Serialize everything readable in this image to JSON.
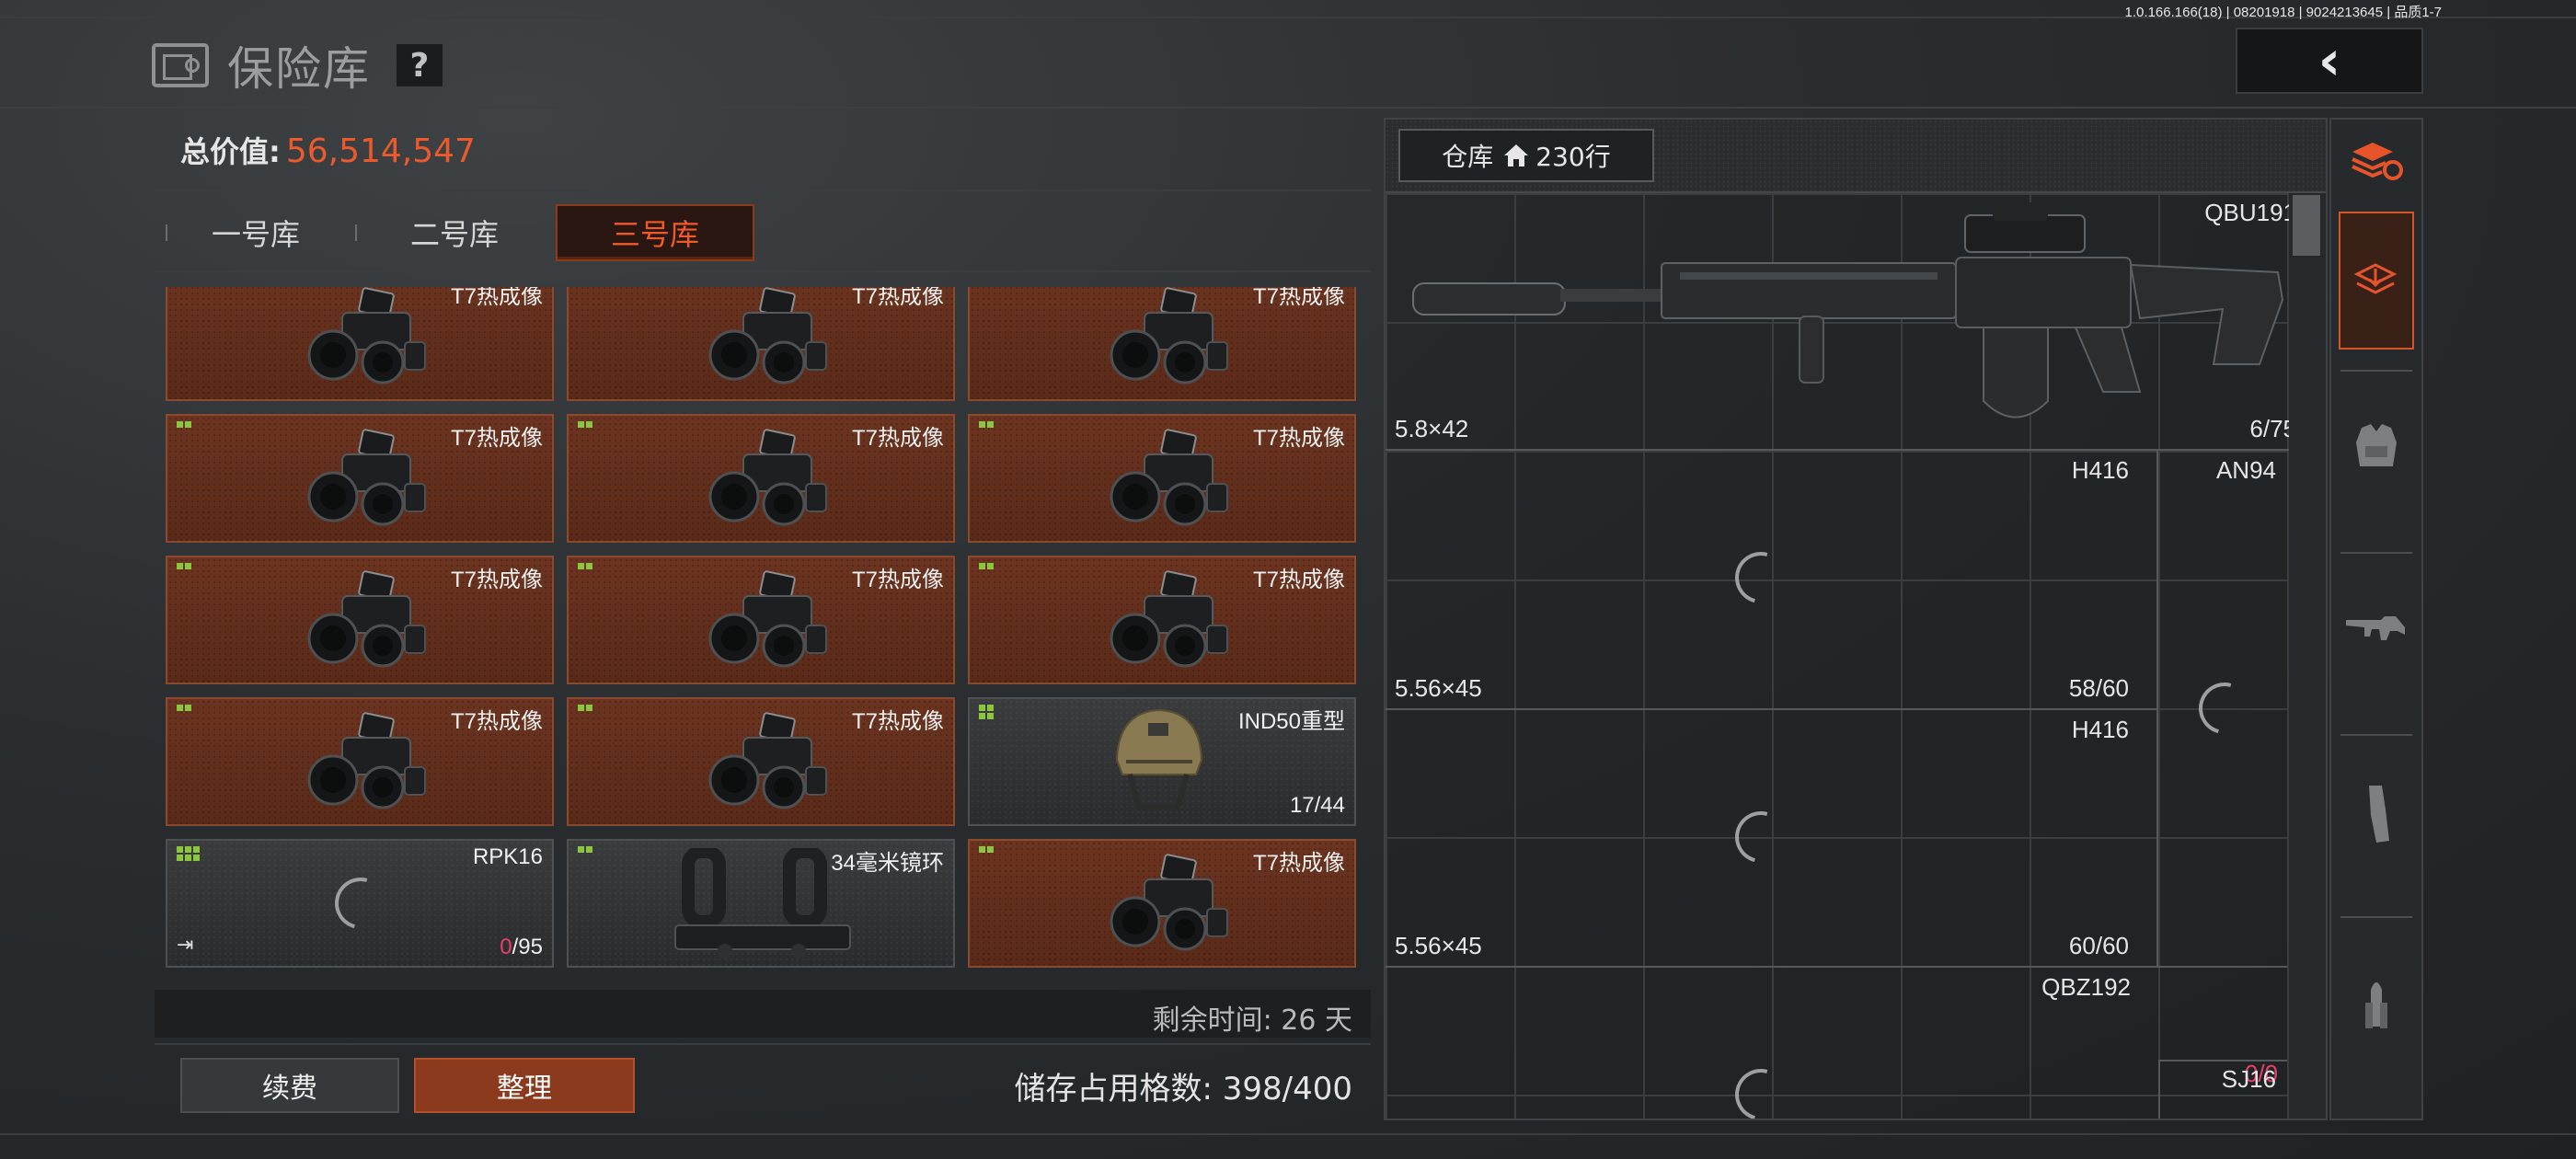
{
  "version_text": "1.0.166.166(18) | 08201918 | 9024213645 | 品质1-7",
  "header": {
    "title": "保险库",
    "help": "?"
  },
  "vault": {
    "total_label": "总价值:",
    "total_value": "56,514,547",
    "tabs": [
      "一号库",
      "二号库",
      "三号库"
    ],
    "active_tab": "三号库",
    "items": [
      {
        "name": "T7热成像",
        "style": "orange",
        "dots": 2,
        "icon": "thermal-scope-icon"
      },
      {
        "name": "T7热成像",
        "style": "orange",
        "dots": 2,
        "icon": "thermal-scope-icon"
      },
      {
        "name": "T7热成像",
        "style": "orange",
        "dots": 2,
        "icon": "thermal-scope-icon"
      },
      {
        "name": "T7热成像",
        "style": "orange",
        "dots": 2,
        "icon": "thermal-scope-icon"
      },
      {
        "name": "T7热成像",
        "style": "orange",
        "dots": 2,
        "icon": "thermal-scope-icon"
      },
      {
        "name": "T7热成像",
        "style": "orange",
        "dots": 2,
        "icon": "thermal-scope-icon"
      },
      {
        "name": "T7热成像",
        "style": "orange",
        "dots": 2,
        "icon": "thermal-scope-icon"
      },
      {
        "name": "T7热成像",
        "style": "orange",
        "dots": 2,
        "icon": "thermal-scope-icon"
      },
      {
        "name": "T7热成像",
        "style": "orange",
        "dots": 2,
        "icon": "thermal-scope-icon"
      },
      {
        "name": "T7热成像",
        "style": "orange",
        "dots": 2,
        "icon": "thermal-scope-icon"
      },
      {
        "name": "T7热成像",
        "style": "orange",
        "dots": 2,
        "icon": "thermal-scope-icon"
      },
      {
        "name": "IND50重型",
        "style": "grey",
        "dots": 4,
        "icon": "helmet-icon",
        "count": "17/44"
      },
      {
        "name": "RPK16",
        "style": "grey",
        "dots": 6,
        "icon": "loading-icon",
        "count_current": "0",
        "count_max": "/95",
        "exit": "⇥"
      },
      {
        "name": "34毫米镜环",
        "style": "grey",
        "dots": 2,
        "icon": "scope-mount-icon"
      },
      {
        "name": "T7热成像",
        "style": "orange",
        "dots": 2,
        "icon": "thermal-scope-icon"
      }
    ],
    "remaining_time": "剩余时间: 26 天",
    "renew_label": "续费",
    "sort_label": "整理",
    "storage_text": "储存占用格数: 398/400"
  },
  "warehouse": {
    "tab_label_prefix": "仓库",
    "tab_label_suffix": "230行",
    "weapons": [
      {
        "name": "QBU191",
        "ammo": "5.8×42",
        "count": "6/75"
      },
      {
        "name": "H416",
        "ammo": "5.56×45",
        "count": "58/60"
      },
      {
        "name": "AN94"
      },
      {
        "name": "H416",
        "ammo": "5.56×45",
        "count": "60/60"
      },
      {
        "name": "QBZ192",
        "count_current": "0",
        "count_max": "/0"
      },
      {
        "name": "SJ16"
      }
    ]
  },
  "rail": {
    "items": [
      "stack-refresh-icon",
      "vault-transfer-icon",
      "vest-icon",
      "rifle-icon",
      "magazine-icon",
      "ammo-icon"
    ],
    "active_index": 1
  },
  "colors": {
    "accent": "#ea5a2c",
    "dot_green": "#8cc63f",
    "count_red": "#e8406a"
  }
}
